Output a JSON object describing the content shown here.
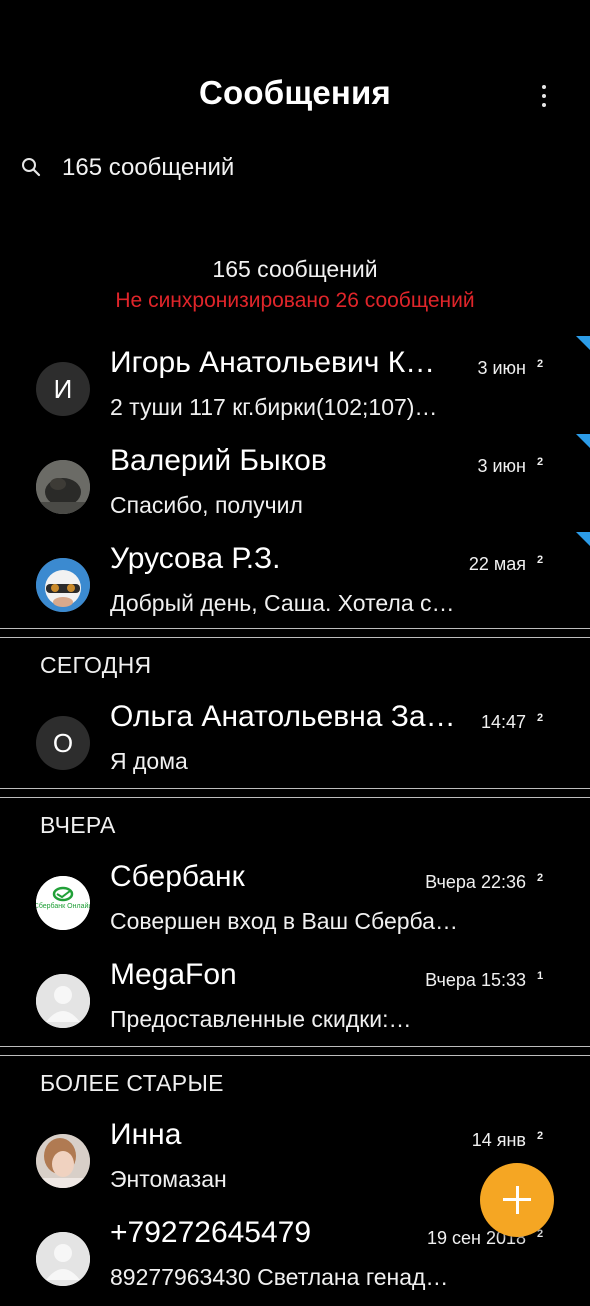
{
  "header": {
    "title": "Сообщения",
    "more_icon": "more-vert-icon"
  },
  "search": {
    "icon": "search-icon",
    "text": "165 сообщений"
  },
  "summary": {
    "count": "165 сообщений",
    "unsynced": "Не синхронизировано 26 сообщений",
    "unsynced_color": "#e0252a"
  },
  "pinned": [
    {
      "avatar_letter": "И",
      "name": "Игорь Анатольевич К…",
      "date": "3 июн",
      "count": "2",
      "snippet": "2 туши 117 кг.бирки(102;107)…",
      "flag": true
    },
    {
      "avatar_letter": "",
      "name": "Валерий Быков",
      "date": "3 июн",
      "count": "2",
      "snippet": "Спасибо, получил",
      "flag": true
    },
    {
      "avatar_letter": "",
      "name": "Урусова Р.З.",
      "date": "22 мая",
      "count": "2",
      "snippet": "Добрый день, Саша. Хотела с…",
      "flag": true
    }
  ],
  "sections": {
    "today": {
      "label": "СЕГОДНЯ",
      "items": [
        {
          "avatar_letter": "О",
          "name": "Ольга Анатольевна За…",
          "date": "14:47",
          "count": "2",
          "snippet": "Я дома"
        }
      ]
    },
    "yesterday": {
      "label": "ВЧЕРА",
      "items": [
        {
          "name": "Сбербанк",
          "date": "Вчера 22:36",
          "count": "2",
          "snippet": "Совершен вход в Ваш Сберба…",
          "avatar_text": "Сбербанк Онлайн"
        },
        {
          "name": "MegaFon",
          "date": "Вчера 15:33",
          "count": "1",
          "snippet": "Предоставленные скидки:…"
        }
      ]
    },
    "older": {
      "label": "БОЛЕЕ СТАРЫЕ",
      "items": [
        {
          "name": "Инна",
          "date": "14 янв",
          "count": "2",
          "snippet": "Энтомазан"
        },
        {
          "name": "+79272645479",
          "date": "19 сен 2018",
          "count": "2",
          "snippet": "89277963430 Светлана генад…"
        }
      ]
    }
  },
  "fab": {
    "icon": "plus-icon",
    "color": "#f5a623"
  },
  "flag_color": "#2c9ce8"
}
